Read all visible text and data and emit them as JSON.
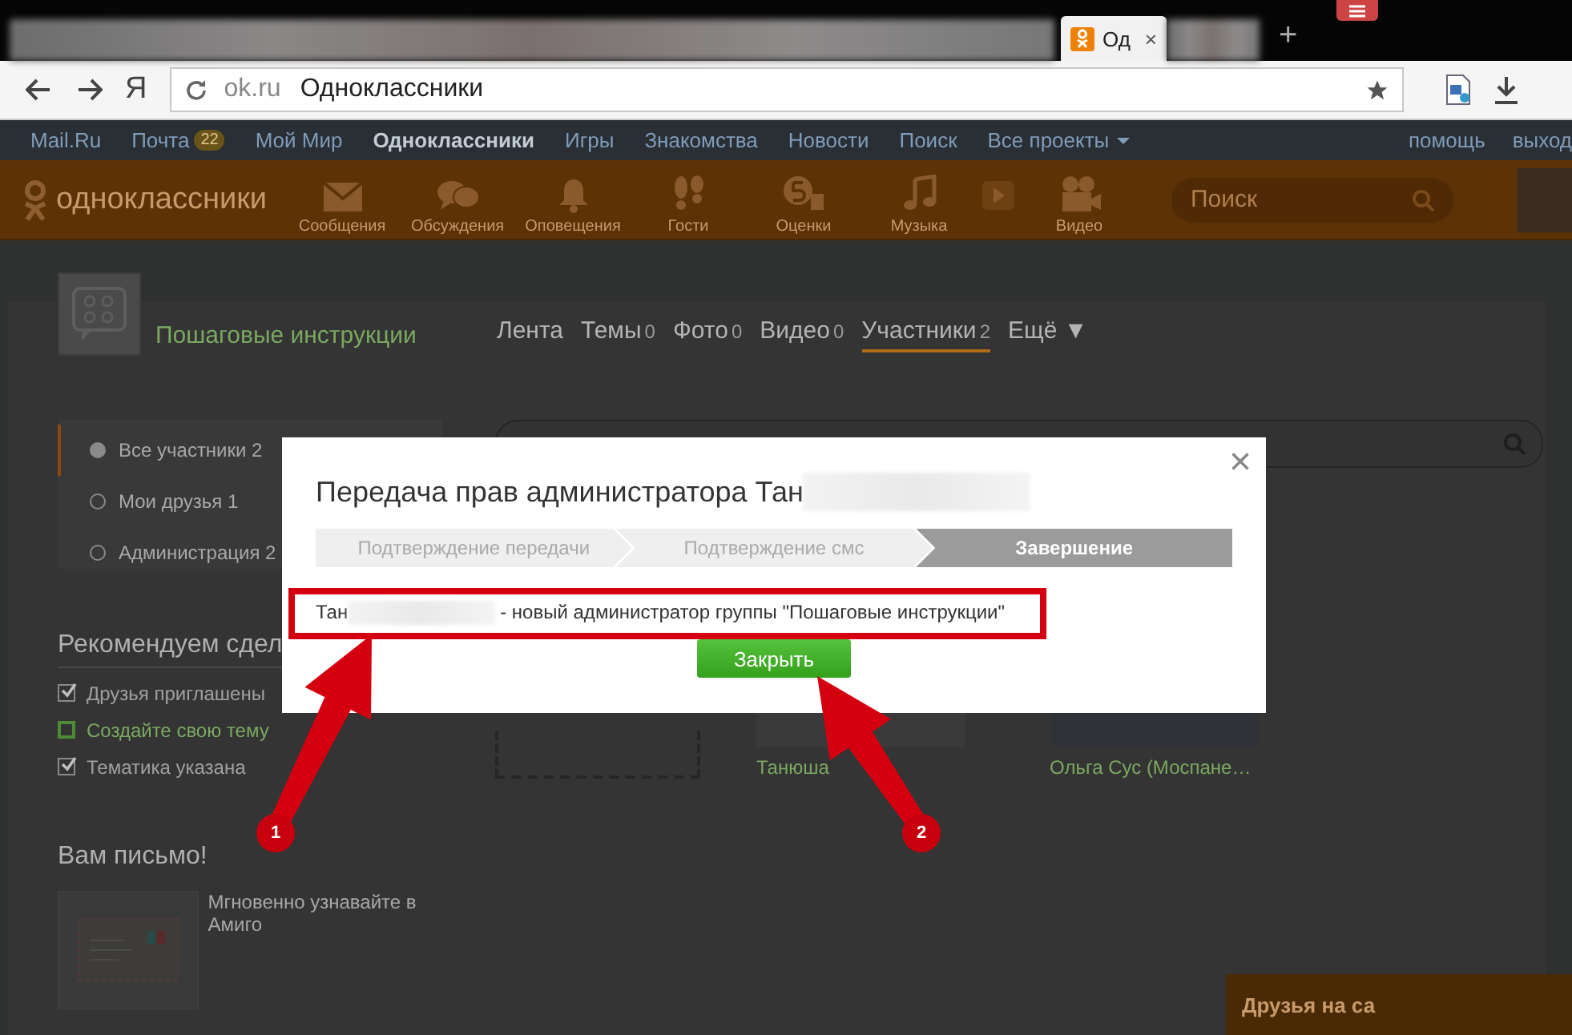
{
  "browser": {
    "tab_title": "Од",
    "tab_close": "×",
    "new_tab": "+",
    "home_button": "Я",
    "address_domain": "ok.ru",
    "address_title": "Одноклассники"
  },
  "portal_bar": {
    "links": [
      {
        "label": "Mail.Ru",
        "selected": false,
        "dropdown": false
      },
      {
        "label": "Почта",
        "badge": "22",
        "selected": false,
        "dropdown": false
      },
      {
        "label": "Мой Мир",
        "selected": false,
        "dropdown": false
      },
      {
        "label": "Одноклассники",
        "selected": true,
        "dropdown": false
      },
      {
        "label": "Игры",
        "selected": false,
        "dropdown": false
      },
      {
        "label": "Знакомства",
        "selected": false,
        "dropdown": false
      },
      {
        "label": "Новости",
        "selected": false,
        "dropdown": false
      },
      {
        "label": "Поиск",
        "selected": false,
        "dropdown": false
      },
      {
        "label": "Все проекты",
        "selected": false,
        "dropdown": true
      }
    ],
    "right_links": [
      "помощь",
      "выход"
    ]
  },
  "toolbar": {
    "logo": "одноклассники",
    "nav": [
      {
        "label": "Сообщения",
        "kind": "envelope"
      },
      {
        "label": "Обсуждения",
        "kind": "chat"
      },
      {
        "label": "Оповещения",
        "kind": "bell"
      },
      {
        "label": "Гости",
        "kind": "footprints"
      },
      {
        "label": "Оценки",
        "kind": "rating"
      },
      {
        "label": "Музыка",
        "kind": "music"
      },
      {
        "label": "Видео",
        "kind": "video"
      }
    ],
    "search": {
      "placeholder": "Поиск"
    }
  },
  "group": {
    "name": "Пошаговые инструкции",
    "tabs": [
      {
        "label": "Лента",
        "selected": false
      },
      {
        "label": "Темы",
        "count": "0",
        "selected": false
      },
      {
        "label": "Фото",
        "count": "0",
        "selected": false
      },
      {
        "label": "Видео",
        "count": "0",
        "selected": false
      },
      {
        "label": "Участники",
        "count": "2",
        "selected": true
      },
      {
        "label": "Ещё ▼",
        "selected": false
      }
    ]
  },
  "members_filter": [
    {
      "label": "Все участники",
      "count": "2",
      "selected": true
    },
    {
      "label": "Мои друзья",
      "count": "1",
      "selected": false
    },
    {
      "label": "Администрация",
      "count": "2",
      "selected": false
    }
  ],
  "recommend": {
    "title": "Рекомендуем сдел",
    "items": [
      {
        "label": "Друзья приглашены",
        "checked": true
      },
      {
        "label": "Создайте свою тему",
        "checked": false
      },
      {
        "label": "Тематика указана",
        "checked": true
      }
    ]
  },
  "mail_promo": {
    "title": "Вам письмо!",
    "text": "Мгновенно узнавайте в Амиго"
  },
  "members": [
    {
      "name": "Танюша"
    },
    {
      "name": "Ольга Сус (Моспане…"
    }
  ],
  "friends_online": {
    "label": "Друзья на са"
  },
  "modal": {
    "title": "Передача прав администратора Тан",
    "close": "×",
    "steps": [
      {
        "label": "Подтверждение передачи",
        "selected": false
      },
      {
        "label": "Подтверждение смс",
        "selected": false
      },
      {
        "label": "Завершение",
        "selected": true
      }
    ],
    "message_prefix": "Тан",
    "message": "- новый администратор группы \"Пошаговые инструкции\"",
    "close_button": "Закрыть"
  },
  "annotations": [
    {
      "label": "1"
    },
    {
      "label": "2"
    }
  ]
}
